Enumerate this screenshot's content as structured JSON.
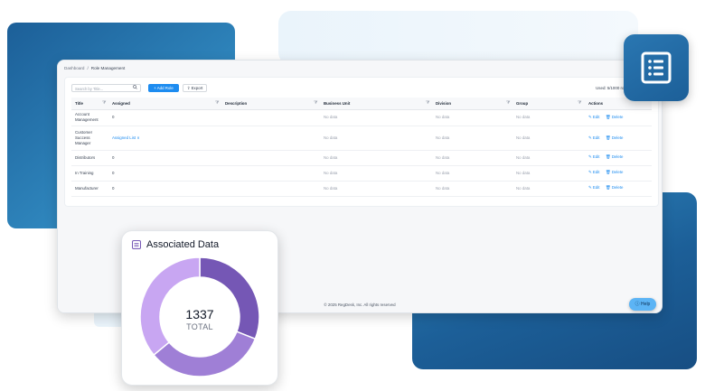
{
  "breadcrumb": {
    "root": "Dashboard",
    "sep": "/",
    "current": "Role Management"
  },
  "toolbar": {
    "search_placeholder": "Search by Title...",
    "add_label": "+ Add Role",
    "export_label": "Export",
    "used_text": "Used: 5/1000 roles"
  },
  "table": {
    "headers": [
      "Title",
      "Assigned",
      "Description",
      "Business Unit",
      "Division",
      "Group",
      "Actions"
    ],
    "rows": [
      {
        "title": [
          "Account",
          "Management"
        ],
        "assigned": "0",
        "description": "",
        "business_unit": "No data",
        "division": "No data",
        "group": "No data"
      },
      {
        "title": [
          "Customer",
          "Success",
          "Manager"
        ],
        "assigned": "Assigned List ∨",
        "description": "",
        "business_unit": "No data",
        "division": "No data",
        "group": "No data"
      },
      {
        "title": [
          "Distributors"
        ],
        "assigned": "0",
        "description": "",
        "business_unit": "No data",
        "division": "No data",
        "group": "No data"
      },
      {
        "title": [
          "In Training"
        ],
        "assigned": "0",
        "description": "",
        "business_unit": "No data",
        "division": "No data",
        "group": "No data"
      },
      {
        "title": [
          "Manufacturer"
        ],
        "assigned": "0",
        "description": "",
        "business_unit": "No data",
        "division": "No data",
        "group": "No data"
      }
    ],
    "action_edit": "Edit",
    "action_delete": "Delete"
  },
  "footer": {
    "copyright": "© 2025 RegDesk, Inc. All rights reserved"
  },
  "help": {
    "label": "Help"
  },
  "associated": {
    "title": "Associated Data",
    "total_value": "1337",
    "total_label": "TOTAL",
    "segments": [
      {
        "fraction": 0.31,
        "color": "#7557b5"
      },
      {
        "fraction": 0.33,
        "color": "#9f7fd6"
      },
      {
        "fraction": 0.36,
        "color": "#c8a6f2"
      }
    ]
  },
  "icons": {
    "search": "search-icon",
    "export": "export-icon",
    "edit": "edit-icon",
    "delete": "delete-icon",
    "list": "list-icon",
    "help": "help-icon",
    "database": "database-icon"
  },
  "colors": {
    "accent": "#1d8cf0",
    "brand_blue": "#1c5f98",
    "help_bg": "#5cb4f5"
  }
}
